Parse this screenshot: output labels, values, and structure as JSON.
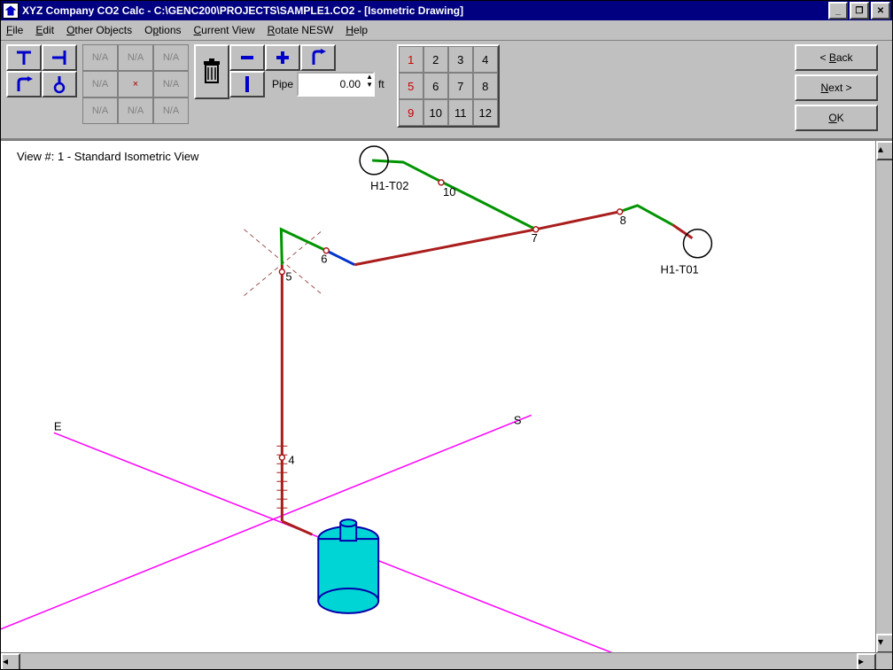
{
  "title": "XYZ Company CO2 Calc - C:\\GENC200\\PROJECTS\\SAMPLE1.CO2 - [Isometric Drawing]",
  "menu": {
    "file": "File",
    "edit": "Edit",
    "other": "Other Objects",
    "options": "Options",
    "view": "Current View",
    "rotate": "Rotate NESW",
    "help": "Help"
  },
  "toolbar": {
    "pipe_label": "Pipe",
    "pipe_value": "0.00",
    "pipe_unit": "ft",
    "na": "N/A",
    "dot": "×",
    "numbers": [
      "1",
      "2",
      "3",
      "4",
      "5",
      "6",
      "7",
      "8",
      "9",
      "10",
      "11",
      "12"
    ],
    "back": "< Back",
    "next": "Next >",
    "ok": "OK"
  },
  "view": {
    "label": "View #: 1 - Standard Isometric View"
  },
  "drawing": {
    "axis": {
      "E": "E",
      "S": "S"
    },
    "nodes": {
      "4": "4",
      "5": "5",
      "6": "6",
      "7": "7",
      "8": "8",
      "10": "10"
    },
    "labels": {
      "t01": "H1-T01",
      "t02": "H1-T02"
    }
  },
  "colors": {
    "axis": "#ff00ff",
    "pipe_a": "#009400",
    "pipe_b": "#0033cc",
    "pipe_c": "#aa1d1d",
    "tank": "#00d5d5"
  }
}
